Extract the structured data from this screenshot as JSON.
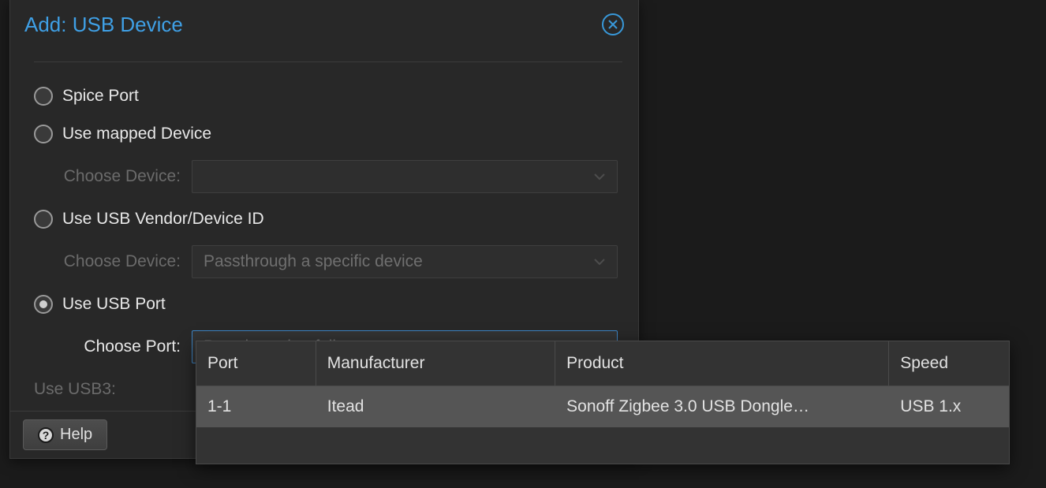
{
  "dialog": {
    "title": "Add: USB Device",
    "options": {
      "spice_port": "Spice Port",
      "mapped_device": "Use mapped Device",
      "vendor_device_id": "Use USB Vendor/Device ID",
      "usb_port": "Use USB Port"
    },
    "fields": {
      "choose_device_label": "Choose Device:",
      "choose_device_placeholder_vendor": "Passthrough a specific device",
      "choose_port_label": "Choose Port:",
      "choose_port_placeholder": "Passthrough a full port",
      "use_usb3_label": "Use USB3:"
    },
    "buttons": {
      "help": "Help"
    }
  },
  "dropdown": {
    "columns": {
      "port": "Port",
      "manufacturer": "Manufacturer",
      "product": "Product",
      "speed": "Speed"
    },
    "rows": [
      {
        "port": "1-1",
        "manufacturer": "Itead",
        "product": "Sonoff Zigbee 3.0 USB Dongle…",
        "speed": "USB 1.x"
      }
    ]
  }
}
